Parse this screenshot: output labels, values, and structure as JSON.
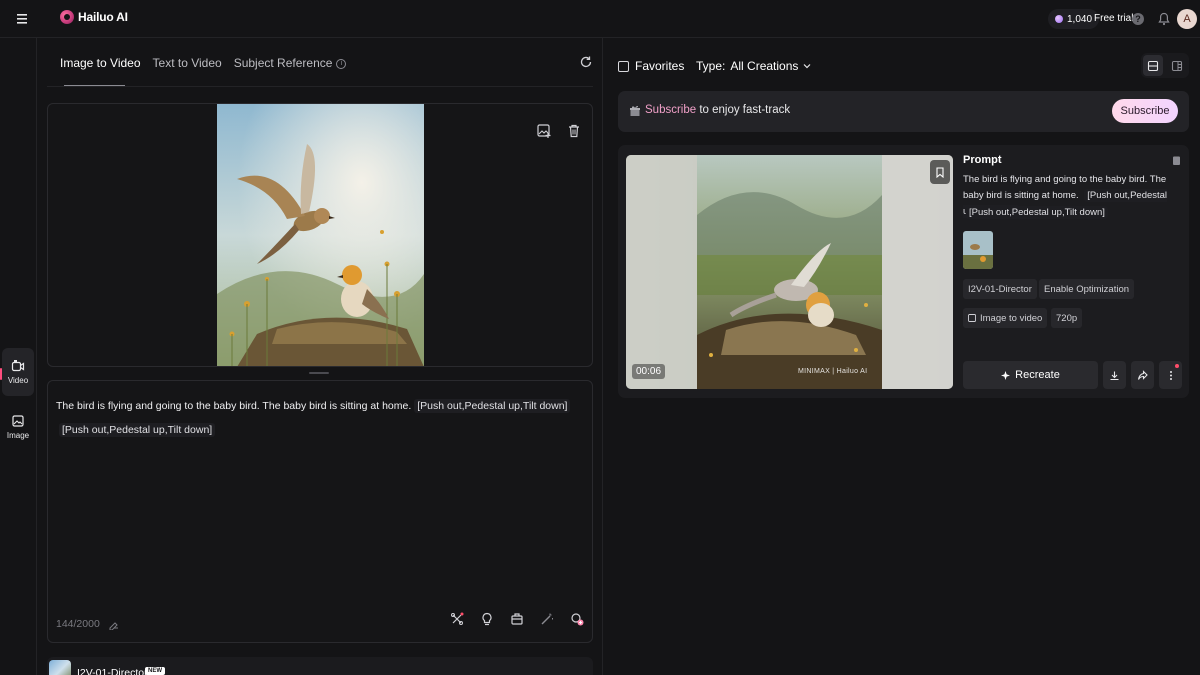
{
  "app": {
    "name": "Hailuo AI",
    "credits": "1,040",
    "free_trial": "Free trial",
    "help": "?",
    "avatar_initial": "A"
  },
  "rail": {
    "items": [
      {
        "label": "Video",
        "icon": "video-icon",
        "active": true
      },
      {
        "label": "Image",
        "icon": "image-icon",
        "active": false
      }
    ]
  },
  "left_panel": {
    "tabs": [
      {
        "label": "Image to Video",
        "active": true
      },
      {
        "label": "Text to Video",
        "active": false
      },
      {
        "label": "Subject Reference",
        "active": false
      }
    ],
    "prompt": {
      "text": "The bird is flying and going to the baby bird. The baby bird is sitting at home.",
      "tag_1": "[Push out,Pedestal up,Tilt down]",
      "tag_2": "[Push out,Pedestal up,Tilt down]",
      "counter": "144/2000"
    },
    "model": {
      "name": "I2V-01-Director",
      "badge": "NEW"
    }
  },
  "right_panel": {
    "favorites_label": "Favorites",
    "type_label": "Type:",
    "type_value": "All Creations",
    "banner": {
      "highlight": "Subscribe",
      "text": " to enjoy fast-track",
      "button": "Subscribe"
    },
    "card": {
      "duration": "00:06",
      "watermark": "MINIMAX | Hailuo AI",
      "prompt_title": "Prompt",
      "prompt_text": "The bird is flying and going to the baby bird. The baby bird is sitting at home.",
      "tag_1": "[Push out,Pedestal up,Tilt down]",
      "tag_2": "[Push out,Pedestal up,Tilt down]",
      "model_chip": "I2V-01-Director",
      "optimization_chip": "Enable Optimization",
      "mode_chip": "Image to video",
      "resolution_chip": "720p",
      "recreate_label": "Recreate"
    }
  },
  "colors": {
    "background": "#141416",
    "panel": "#1c1c1f",
    "accent_pink": "#f0a0c8",
    "accent_red": "#ff4d7e"
  }
}
